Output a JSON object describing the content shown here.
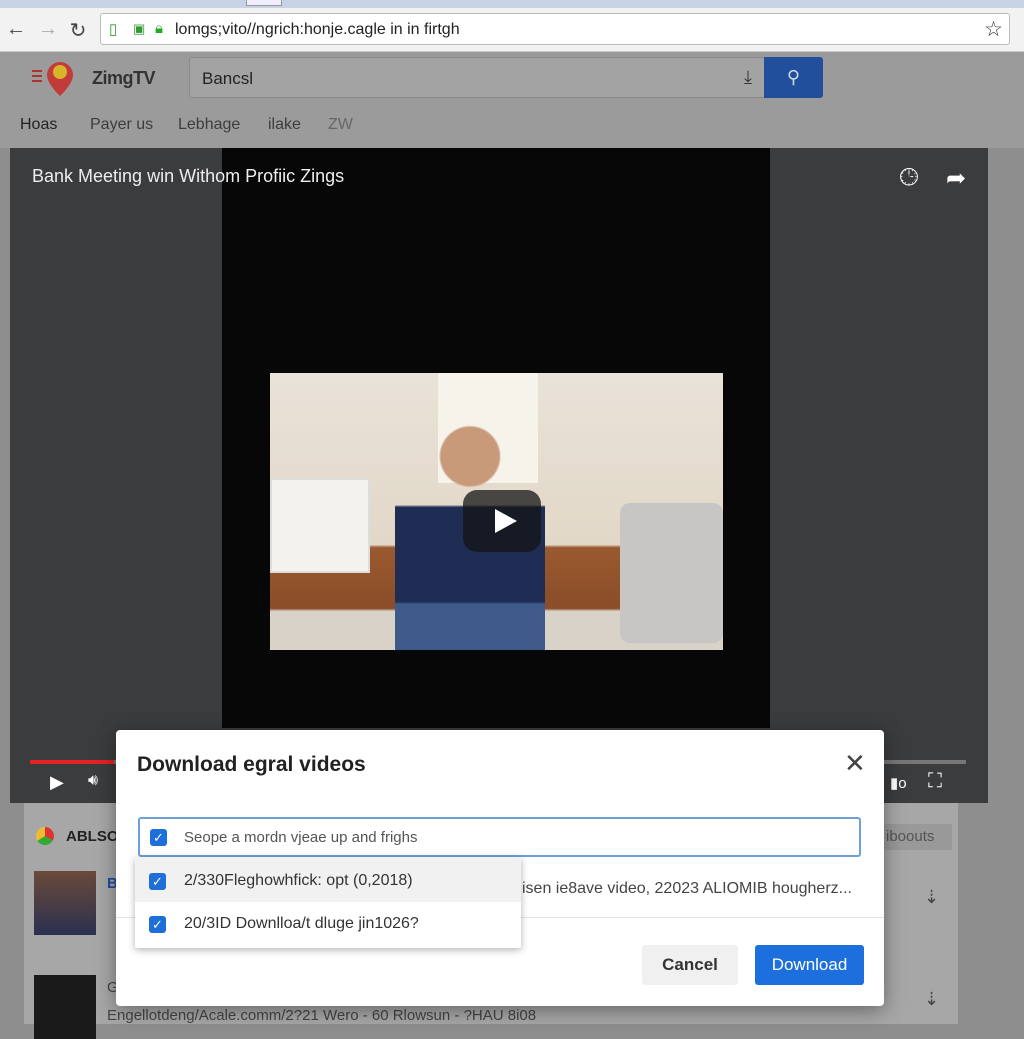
{
  "browser": {
    "url": "lomgs;vito//ngrich:honje.cagle in in firtgh"
  },
  "site": {
    "brand": "ZimgTV",
    "search_value": "Bancsl",
    "nav": [
      "Hoas",
      "Payer us",
      "Lebhage",
      "ilake",
      "ZW"
    ],
    "accent": "#214f9b"
  },
  "video": {
    "title": "Bank Meeting win Withom Profiic Zings",
    "progress_percent": 9
  },
  "list": {
    "source_label": "ABLSO",
    "item1_prefix": "B",
    "item2_prefix": "G",
    "sidebar_button": "iboouts",
    "item2_caption": "Engellotdeng/Acale.comm/2?21 Wero - 60 Rlowsun - ?HAU 8i08"
  },
  "dialog": {
    "title": "Download egral videos",
    "input_text": "Seope a mordn vjeae up and frighs",
    "options": [
      "2/330Fleghowhfick: opt (0,2018)",
      "20/3ID Downlloa/t dluge jin1026?"
    ],
    "background_text": "isen ie8ave video, 22023 ALIOMIB hougherz...",
    "cancel": "Cancel",
    "download": "Download",
    "primary_color": "#1c6fdc"
  }
}
